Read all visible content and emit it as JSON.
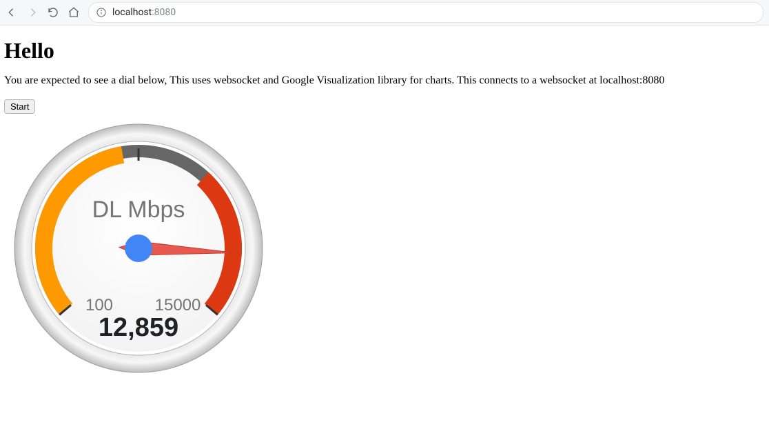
{
  "browser": {
    "url_host": "localhost",
    "url_port": ":8080"
  },
  "page": {
    "heading": "Hello",
    "description": "You are expected to see a dial below, This uses websocket and Google Visualization library for charts. This connects to a websocket at localhost:8080",
    "start_button": "Start"
  },
  "gauge": {
    "label": "DL Mbps",
    "min_display": "100",
    "max_display": "15000",
    "value_display": "12,859",
    "min": 100,
    "max": 15000,
    "value": 12859,
    "yellow_from": 100,
    "yellow_to": 7000,
    "red_from": 10000,
    "red_to": 15000
  },
  "chart_data": {
    "type": "gauge",
    "title": "DL Mbps",
    "min": 100,
    "max": 15000,
    "value": 12859,
    "ranges": [
      {
        "name": "yellow",
        "from": 100,
        "to": 7000,
        "color": "#ff9900"
      },
      {
        "name": "red",
        "from": 10000,
        "to": 15000,
        "color": "#dc3912"
      }
    ]
  }
}
